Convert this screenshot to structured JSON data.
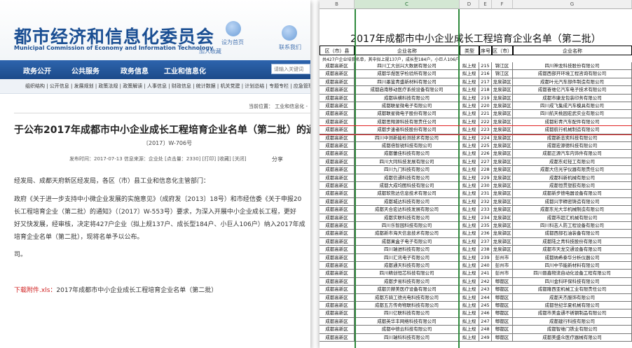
{
  "left": {
    "site_title": "都市经济和信息化委员会",
    "site_subtitle": "Municipal Commission of Economy and Information Technology",
    "header_links": [
      "设为首页",
      "加入收藏",
      "联系我们"
    ],
    "nav": [
      "政务公开",
      "公共服务",
      "政务信息",
      "工业和信息化"
    ],
    "search_placeholder": "请输入关键词",
    "subnav": "组织结构 | 公开信息 | 发展规划 | 政策法规 | 政策解读 | 人事信息 | 财政信息 | 统计数据 | 机关党建 | 计划总结 | 专题专栏 | 应急管理",
    "breadcrumb": "当前位置： 工业和信息化 -",
    "article": {
      "title": "于公布2017年成都市中小企业成长工程培育企业名单（第二批）的通",
      "doc_no": "〔2017〕W-706号",
      "meta": "发布时间：2017-07-13 信息来源：企业处 [点击量：2330] [打印] [收藏] [关闭]",
      "share": "分享",
      "paragraphs": [
        "经发局、成都天府新区经发局，各区（市）县工业和信息化主管部门：",
        "政府《关于进一步支持中小微企业发展的实施意见》（成府发〔2013〕18号）和市经信委《关于申报20",
        "长工程培育企业（第二批）的通知》（〔2017〕W-553号）要求，为深入开展中小企业成长工程，更好",
        "好又快发展，经审核，决定将427户企业（拟上规137户、成长型184户、小巨人106户）纳入2017年成",
        "培育企业名单（第二批），现将名单予以公布。",
        "司。"
      ],
      "attachment_label": "下载附件.xls：",
      "attachment_file": "2017年成都市中小企业成长工程培育企业名单（第二批）"
    }
  },
  "right": {
    "columns": [
      "B",
      "C",
      "D",
      "E",
      "F",
      "G"
    ],
    "sheet_title": "2017年成都市中小企业成长工程培育企业名单（第二批）",
    "headers": [
      "区（市）县",
      "企业名称",
      "类型",
      "序号",
      "区（市）县",
      "企业名称"
    ],
    "summary": "共427户企业培育名单，其中拟上规137户，成长型184户，小巨人106户",
    "rows": [
      [
        "成都高新区",
        "四川工大创兴大数据有限公司",
        "拟上规",
        "215",
        "锦江区",
        "四川神龙科技股份有限公司"
      ],
      [
        "成都高新区",
        "成都华煜医学检验所有限公司",
        "拟上规",
        "216",
        "锦江区",
        "成都西部开环境工程咨询有限公司"
      ],
      [
        "成都高新区",
        "四川墨鉴青盛新材料有限公司",
        "拟上规",
        "217",
        "龙泉驿区",
        "成都叶元汽车部件制造有限公司"
      ],
      [
        "成都高新区",
        "成都启南移动医疗系统设备有限公司",
        "拟上规",
        "218",
        "龙泉驿区",
        "成都奋维亿汽车电子技术有限公司"
      ],
      [
        "成都高新区",
        "成都纵横科技有限公司",
        "拟上规",
        "219",
        "龙泉驿区",
        "成都市康龙包装印务有限公司"
      ],
      [
        "成都高新区",
        "成都联星微电子有限公司",
        "拟上规",
        "220",
        "龙泉驿区",
        "四川成飞集成汽车模具有限公司"
      ],
      [
        "成都高新区",
        "成都联星微电子股份有限公司",
        "拟上规",
        "221",
        "龙泉驿区",
        "四川航天桃园宏武实业有限公司"
      ],
      [
        "成都高新区",
        "成都思翔源科技有限责任公司",
        "拟上规",
        "222",
        "龙泉驿区",
        "成都彩青汽车配件有限公司"
      ],
      [
        "成都高新区",
        "成都步速者科技股份有限公司",
        "拟上规",
        "223",
        "龙泉驿区",
        "成都航行机械制造有限公司"
      ],
      [
        "成都高新区",
        "四川中测新能检测技术有限公司",
        "拟上规",
        "224",
        "龙泉驿区",
        "成都新志奕科技有限公司"
      ],
      [
        "成都高新区",
        "成都倍智锐科技有限公司",
        "拟上规",
        "225",
        "龙泉驿区",
        "成都宏源德科技有限公司"
      ],
      [
        "成都高新区",
        "成都蕾佳科技有限公司",
        "拟上规",
        "226",
        "龙泉驿区",
        "成都正源汽车内饰件有限公司"
      ],
      [
        "成都高新区",
        "四川大同科技发展有限公司",
        "拟上规",
        "227",
        "龙泉驿区",
        "成都东虹轻工有限公司"
      ],
      [
        "成都高新区",
        "四川九门科技有限公司",
        "拟上规",
        "228",
        "龙泉驿区",
        "成都大信光学仪器有限责任公司"
      ],
      [
        "成都高新区",
        "成都信通科技有限公司",
        "拟上规",
        "229",
        "龙泉驿区",
        "成都科新机械有限公司"
      ],
      [
        "成都高新区",
        "成都大成均图科技有限公司",
        "拟上规",
        "230",
        "龙泉驿区",
        "成都恒贯塑胶有限公司"
      ],
      [
        "成都高新区",
        "成都软熊达信息技术有限公司",
        "拟上规",
        "231",
        "龙泉驿区",
        "成都新步德电器设备有限公司"
      ],
      [
        "成都高新区",
        "成都城达科技有限公司",
        "拟上规",
        "232",
        "龙泉驿区",
        "成都兴宇精密铸造有限公司"
      ],
      [
        "成都高新区",
        "成都天合宏达科技发展有限公司",
        "拟上规",
        "233",
        "龙泉驿区",
        "成都东光大华机械制造有限公司"
      ],
      [
        "成都高新区",
        "成都实联科技有限公司",
        "拟上规",
        "234",
        "龙泉驿区",
        "成都市超汇机械有限公司"
      ],
      [
        "成都高新区",
        "四川乐智园科技有限公司",
        "拟上规",
        "235",
        "龙泉驿区",
        "四川科志人防工程设备有限公司"
      ],
      [
        "成都高新区",
        "成都新市海天信息技术有限公司",
        "拟上规",
        "236",
        "龙泉驿区",
        "成都西部石油装备有限公司"
      ],
      [
        "成都高新区",
        "成都果盒子电子有限公司",
        "拟上规",
        "237",
        "龙泉驿区",
        "成都陆之青科技股份有限公司"
      ],
      [
        "成都高新区",
        "四川瑞进科技有限公司",
        "拟上规",
        "238",
        "龙泉驿区",
        "成都市天龙交通设备有限公司"
      ],
      [
        "成都高新区",
        "四川汇讯电子有限公司",
        "拟上规",
        "239",
        "彭州市",
        "成都纳希泰华分析仪器公司"
      ],
      [
        "成都高新区",
        "成都通天科技有限公司",
        "拟上规",
        "240",
        "彭州市",
        "四川中节能新材料有限公司"
      ],
      [
        "成都高新区",
        "四川精创恒芯科技有限公司",
        "拟上规",
        "241",
        "彭州市",
        "四川晋鑫物流自动化设备工程有限公司"
      ],
      [
        "成都高新区",
        "成都步易科技有限公司",
        "拟上规",
        "242",
        "郫都区",
        "四川金科环保科技有限公司"
      ],
      [
        "成都高新区",
        "成都贝赫美医疗设备有限公司",
        "拟上规",
        "243",
        "郫都区",
        "成都隆西亚机械工业有限责任公司"
      ],
      [
        "成都高新区",
        "成都方骑工德光电科技有限公司",
        "拟上规",
        "244",
        "郫都区",
        "成都天杰服饰有限公司"
      ],
      [
        "成都高新区",
        "成都五方传奇物联科技有限公司",
        "拟上规",
        "245",
        "郫都区",
        "成都世纪华夏机械有限公司"
      ],
      [
        "成都高新区",
        "四川亿联科技有限公司",
        "拟上规",
        "246",
        "郫都区",
        "成都市美金通不锈钢制品有限公司"
      ],
      [
        "成都高新区",
        "成都英华丰网络科技有限公司",
        "拟上规",
        "247",
        "郫都区",
        "成都建行科技有限公司"
      ],
      [
        "成都高新区",
        "成都中德云科技有限公司",
        "拟上规",
        "248",
        "郫都区",
        "成都智维门铁业有限公司"
      ],
      [
        "成都高新区",
        "四川瑞科科技有限公司",
        "拟上规",
        "249",
        "郫都区",
        "成都美盛众医疗器械有限公司"
      ]
    ],
    "highlighted_row_index": 8
  }
}
